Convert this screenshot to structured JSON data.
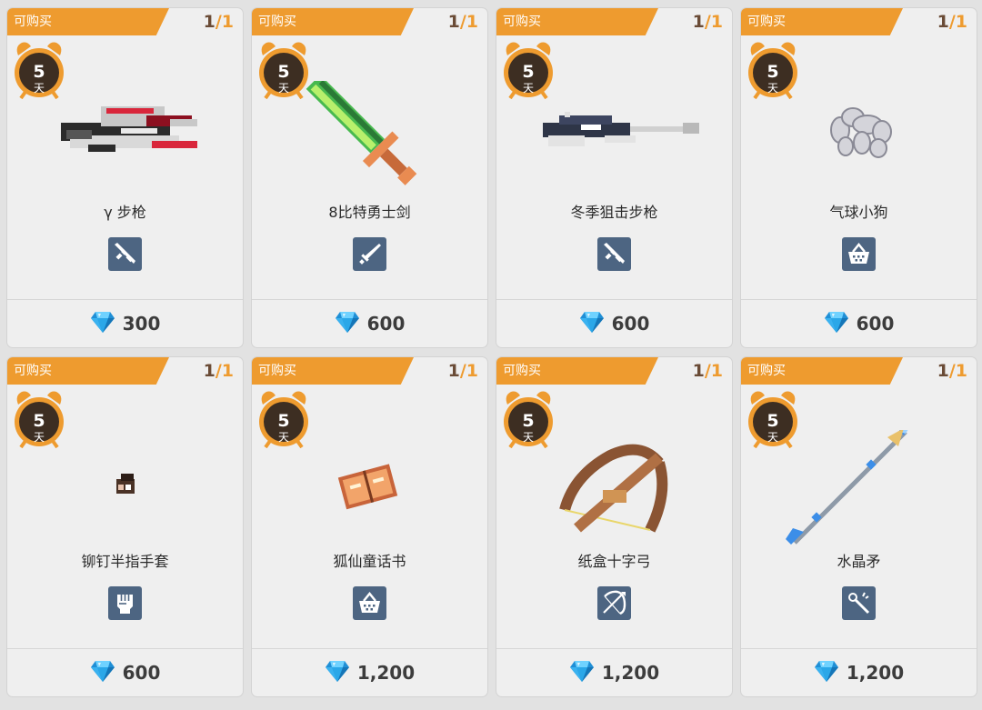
{
  "labels": {
    "available": "可购买",
    "slash": "/",
    "days_unit": "天"
  },
  "items": [
    {
      "name": "γ 步枪",
      "stock": "1",
      "stock_total": "1",
      "days": "5",
      "price": "300",
      "type_icon": "rifle-icon",
      "art": "gamma-rifle"
    },
    {
      "name": "8比特勇士剑",
      "stock": "1",
      "stock_total": "1",
      "days": "5",
      "price": "600",
      "type_icon": "sword-icon",
      "art": "pixel-sword"
    },
    {
      "name": "冬季狙击步枪",
      "stock": "1",
      "stock_total": "1",
      "days": "5",
      "price": "600",
      "type_icon": "rifle-icon",
      "art": "sniper-rifle"
    },
    {
      "name": "气球小狗",
      "stock": "1",
      "stock_total": "1",
      "days": "5",
      "price": "600",
      "type_icon": "basket-icon",
      "art": "balloon-dog"
    },
    {
      "name": "铆钉半指手套",
      "stock": "1",
      "stock_total": "1",
      "days": "5",
      "price": "600",
      "type_icon": "fist-icon",
      "art": "glove"
    },
    {
      "name": "狐仙童话书",
      "stock": "1",
      "stock_total": "1",
      "days": "5",
      "price": "1,200",
      "type_icon": "basket-icon",
      "art": "fairy-book"
    },
    {
      "name": "纸盒十字弓",
      "stock": "1",
      "stock_total": "1",
      "days": "5",
      "price": "1,200",
      "type_icon": "bow-icon",
      "art": "crossbow"
    },
    {
      "name": "水晶矛",
      "stock": "1",
      "stock_total": "1",
      "days": "5",
      "price": "1,200",
      "type_icon": "staff-icon",
      "art": "crystal-spear"
    }
  ],
  "colors": {
    "banner": "#ee9b2f",
    "badge": "#4d6582",
    "clock": "#3d2e22",
    "gem": "#2aa7e8"
  }
}
